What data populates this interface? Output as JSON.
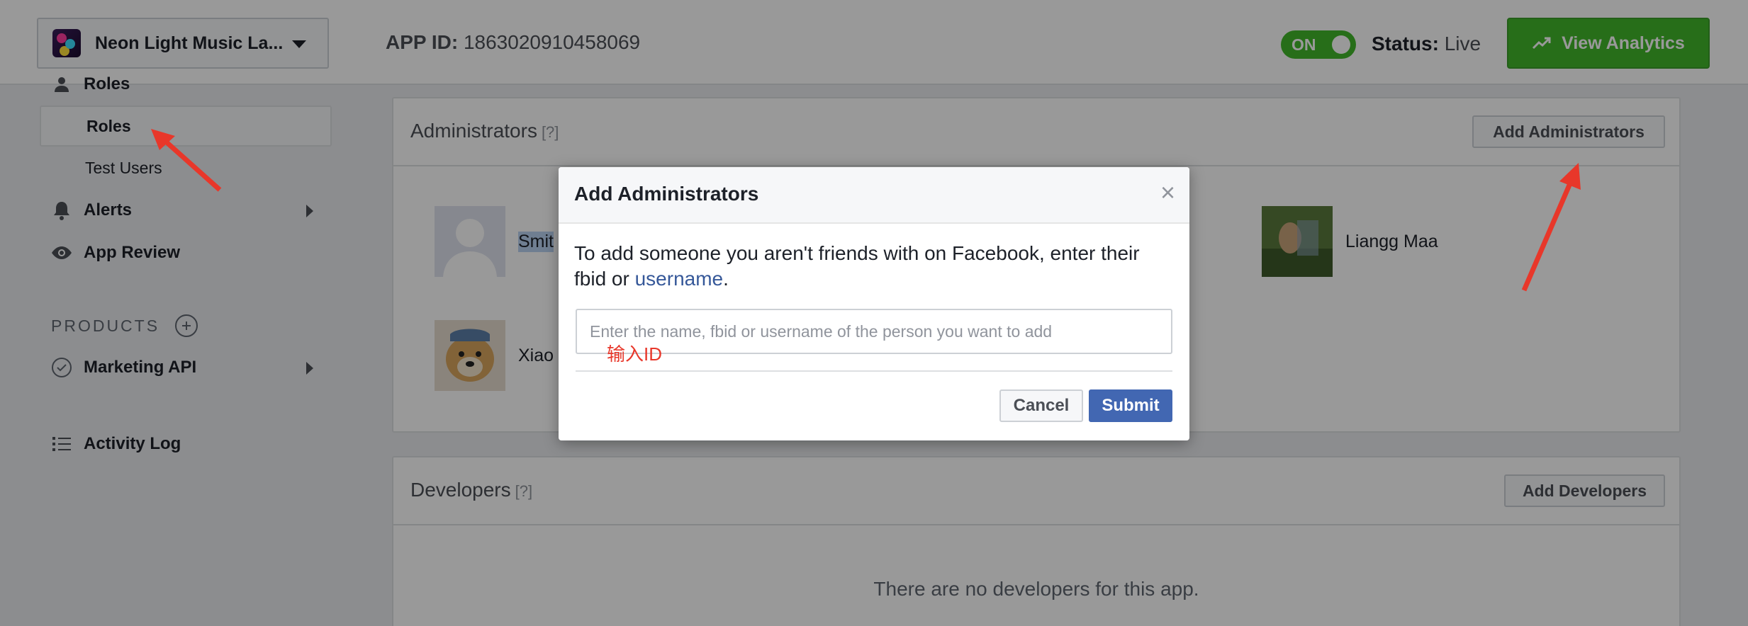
{
  "topbar": {
    "app_name": "Neon Light Music La...",
    "app_id_label": "APP ID:",
    "app_id_value": "1863020910458069",
    "toggle_label": "ON",
    "status_label": "Status:",
    "status_value": "Live",
    "analytics_button": "View Analytics"
  },
  "sidebar": {
    "roles_header": "Roles",
    "roles_sub": "Roles",
    "test_users": "Test Users",
    "alerts": "Alerts",
    "app_review": "App Review",
    "products_header": "PRODUCTS",
    "marketing_api": "Marketing API",
    "activity_log": "Activity Log"
  },
  "administrators": {
    "title": "Administrators",
    "help": "[?]",
    "add_button": "Add Administrators",
    "members": [
      {
        "name": "Smit"
      },
      {
        "name": "Liangg Maa"
      },
      {
        "name": "Xiao"
      }
    ]
  },
  "developers": {
    "title": "Developers",
    "help": "[?]",
    "add_button": "Add Developers",
    "empty_message": "There are no developers for this app."
  },
  "modal": {
    "title": "Add Administrators",
    "close": "×",
    "text_before": "To add someone you aren't friends with on Facebook, enter their fbid or ",
    "link_text": "username",
    "text_after": ".",
    "input_placeholder": "Enter the name, fbid or username of the person you want to add",
    "input_value": "",
    "annotation": "输入ID",
    "cancel": "Cancel",
    "submit": "Submit"
  },
  "colors": {
    "accent_green": "#42b72a",
    "submit_blue": "#4267b2",
    "link_blue": "#365899",
    "annotation_red": "#e8372a"
  }
}
